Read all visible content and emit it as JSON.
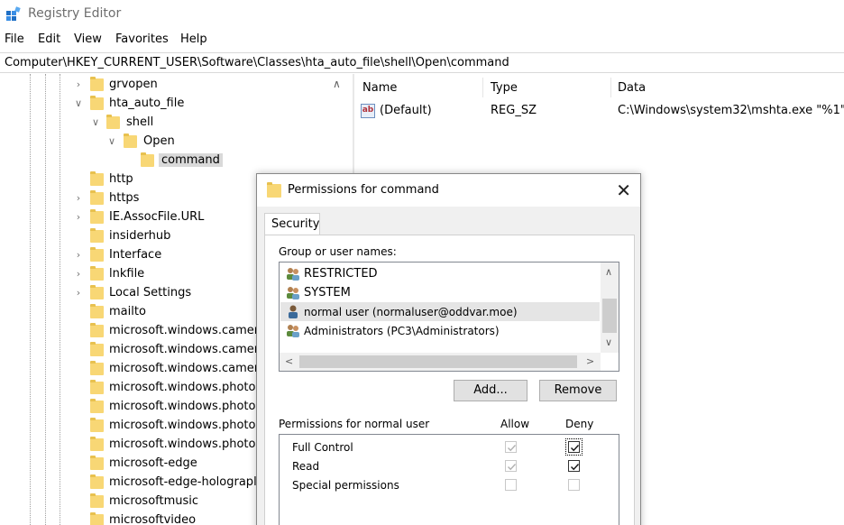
{
  "window": {
    "title": "Registry Editor",
    "icon": "regedit-icon"
  },
  "menu": [
    "File",
    "Edit",
    "View",
    "Favorites",
    "Help"
  ],
  "address": "Computer\\HKEY_CURRENT_USER\\Software\\Classes\\hta_auto_file\\shell\\Open\\command",
  "tree": {
    "items": [
      {
        "label": "grvopen",
        "expander": ">"
      },
      {
        "label": "hta_auto_file",
        "expander": "v"
      },
      {
        "label": "shell",
        "expander": "v"
      },
      {
        "label": "Open",
        "expander": "v"
      },
      {
        "label": "command",
        "expander": ""
      },
      {
        "label": "http",
        "expander": ""
      },
      {
        "label": "https",
        "expander": ">"
      },
      {
        "label": "IE.AssocFile.URL",
        "expander": ">"
      },
      {
        "label": "insiderhub",
        "expander": ""
      },
      {
        "label": "Interface",
        "expander": ">"
      },
      {
        "label": "lnkfile",
        "expander": ">"
      },
      {
        "label": "Local Settings",
        "expander": ">"
      },
      {
        "label": "mailto",
        "expander": ""
      },
      {
        "label": "microsoft.windows.camer",
        "expander": ""
      },
      {
        "label": "microsoft.windows.camer",
        "expander": ""
      },
      {
        "label": "microsoft.windows.camer",
        "expander": ""
      },
      {
        "label": "microsoft.windows.photos",
        "expander": ""
      },
      {
        "label": "microsoft.windows.photos",
        "expander": ""
      },
      {
        "label": "microsoft.windows.photos",
        "expander": ""
      },
      {
        "label": "microsoft.windows.photos",
        "expander": ""
      },
      {
        "label": "microsoft-edge",
        "expander": ""
      },
      {
        "label": "microsoft-edge-holograpl",
        "expander": ""
      },
      {
        "label": "microsoftmusic",
        "expander": ""
      },
      {
        "label": "microsoftvideo",
        "expander": ""
      }
    ],
    "selected": "command"
  },
  "values": {
    "columns": [
      "Name",
      "Type",
      "Data"
    ],
    "rows": [
      {
        "name": "(Default)",
        "type": "REG_SZ",
        "data": "C:\\Windows\\system32\\mshta.exe \"%1\"",
        "icon": "string-value-icon"
      }
    ]
  },
  "dialog": {
    "title": "Permissions for command",
    "tab": "Security",
    "group_label": "Group or user names:",
    "users": [
      {
        "name": "RESTRICTED",
        "icon": "group-icon"
      },
      {
        "name": "SYSTEM",
        "icon": "group-icon"
      },
      {
        "name": "normal user (normaluser@oddvar.moe)",
        "icon": "user-icon",
        "selected": true
      },
      {
        "name": "Administrators (PC3\\Administrators)",
        "icon": "group-icon"
      }
    ],
    "add_label": "Add...",
    "remove_label": "Remove",
    "perm_label": "Permissions for normal user",
    "allow_label": "Allow",
    "deny_label": "Deny",
    "permissions": [
      {
        "name": "Full Control",
        "allow": true,
        "allow_disabled": true,
        "deny": true
      },
      {
        "name": "Read",
        "allow": true,
        "allow_disabled": true,
        "deny": true
      },
      {
        "name": "Special permissions",
        "allow": false,
        "allow_disabled": true,
        "deny": false
      }
    ]
  },
  "colors": {
    "folder": "#f8d775",
    "selection": "#d9d9d9",
    "dialog_bg": "#f0f0f0"
  }
}
